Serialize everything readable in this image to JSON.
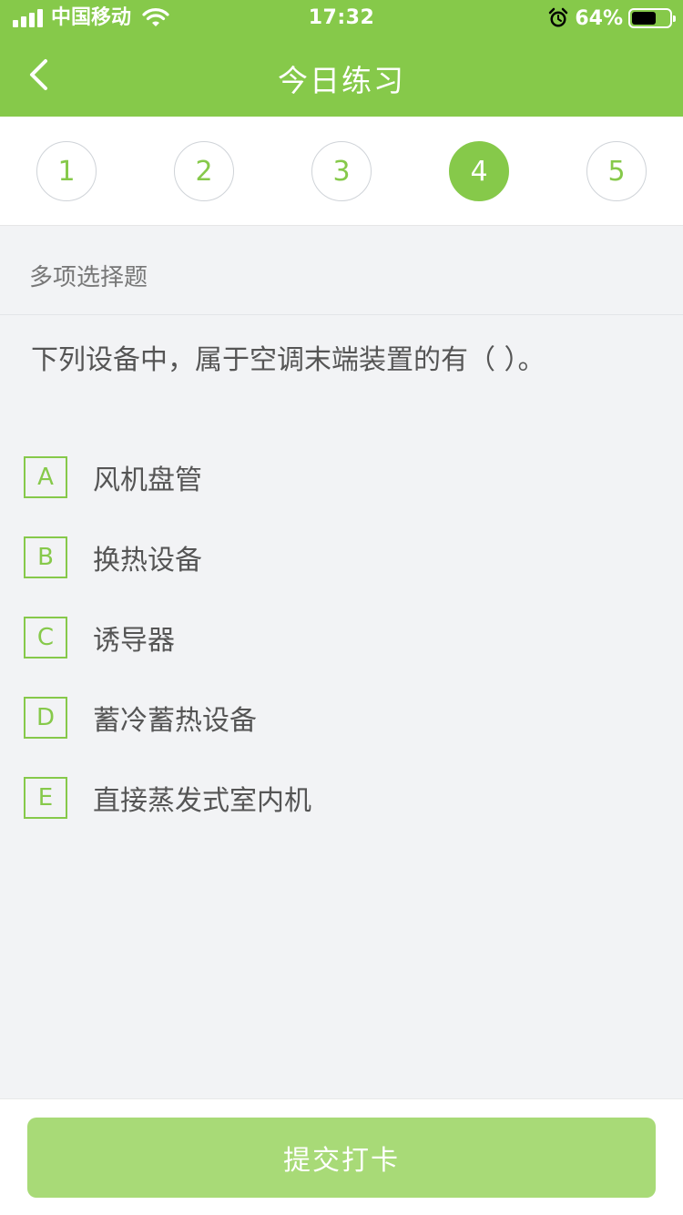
{
  "status_bar": {
    "carrier": "中国移动",
    "time": "17:32",
    "battery_percent": "64%",
    "battery_level": 0.64,
    "icons": [
      "signal-icon",
      "wifi-icon",
      "alarm-icon",
      "battery-icon"
    ]
  },
  "nav": {
    "title": "今日练习",
    "back_icon": "chevron-left-icon"
  },
  "question_numbers": {
    "items": [
      "1",
      "2",
      "3",
      "4",
      "5"
    ],
    "active": "4"
  },
  "question": {
    "type": "多项选择题",
    "text": "下列设备中，属于空调末端装置的有（   ）。",
    "options": [
      {
        "letter": "A",
        "text": "风机盘管"
      },
      {
        "letter": "B",
        "text": "换热设备"
      },
      {
        "letter": "C",
        "text": "诱导器"
      },
      {
        "letter": "D",
        "text": "蓄冷蓄热设备"
      },
      {
        "letter": "E",
        "text": "直接蒸发式室内机"
      }
    ]
  },
  "footer": {
    "submit_label": "提交打卡"
  },
  "colors": {
    "accent": "#86c94a",
    "submit_bg": "#a8da77",
    "background": "#f2f3f5"
  }
}
